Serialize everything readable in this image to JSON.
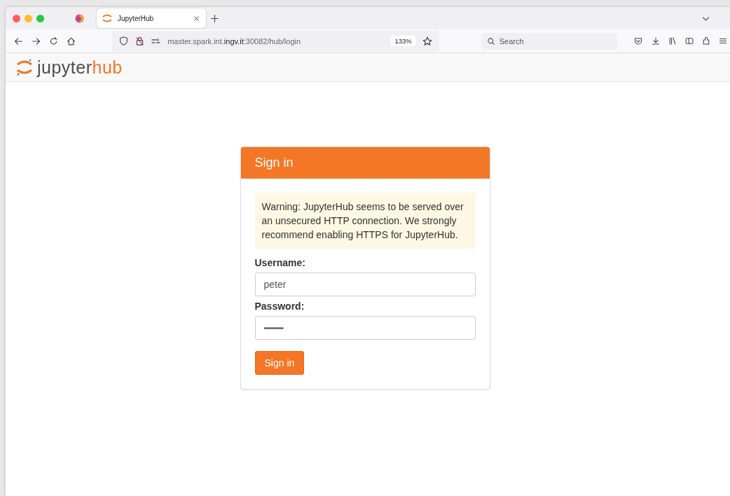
{
  "browser": {
    "tabs": [
      {
        "title": "JupyterHub",
        "selected": true
      }
    ],
    "url": "master.spark.int.**ingv.it**:30082/hub/login",
    "zoom": "133%",
    "search": {
      "placeholder": "Search"
    }
  },
  "header": {
    "logo_main": "jupyter",
    "logo_accent": "hub"
  },
  "login": {
    "title": "Sign in",
    "warning": "Warning: JupyterHub seems to be served over an unsecured HTTP connection. We strongly recommend enabling HTTPS for JupyterHub.",
    "username": {
      "label": "Username:",
      "value": "peter"
    },
    "password": {
      "label": "Password:",
      "value": "•••••••••••"
    },
    "button": "Sign in"
  }
}
